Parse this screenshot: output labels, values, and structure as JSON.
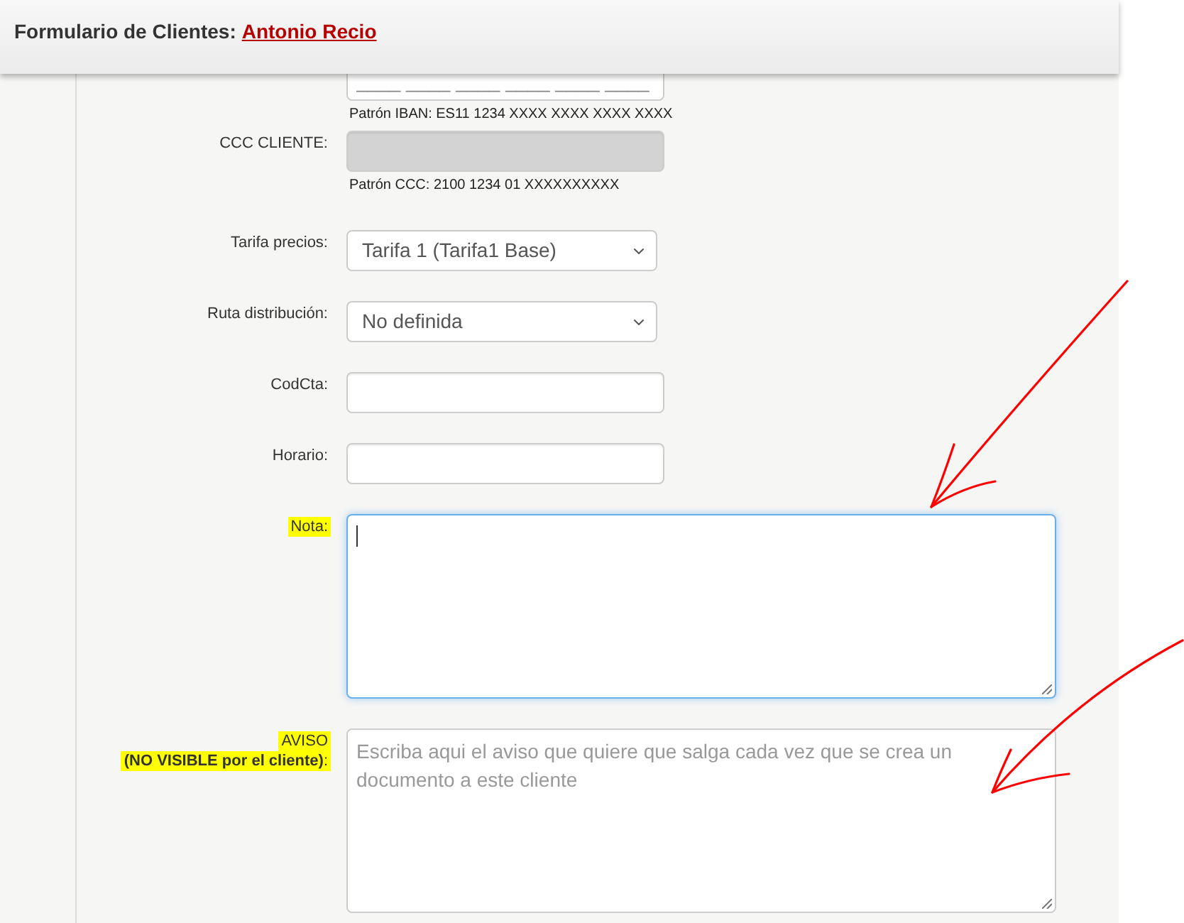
{
  "header": {
    "title": "Formulario de Clientes:",
    "client_name": "Antonio Recio"
  },
  "fields": [
    {
      "kind": "masked",
      "placeholder": "____ ____ ____ ____ ____ ____",
      "hint": "Patrón IBAN: ES11 1234 XXXX XXXX XXXX XXXX",
      "disabled": false,
      "focused": false
    },
    {
      "kind": "text",
      "label": "CCC CLIENTE:",
      "highlighted": false,
      "disabled": true,
      "focused": false,
      "hint": "Patrón CCC: 2100 1234 01 XXXXXXXXXX"
    },
    {
      "kind": "select",
      "label": "Tarifa precios:",
      "highlighted": false,
      "value": "Tarifa 1 (Tarifa1 Base)",
      "disabled": false,
      "focused": false
    },
    {
      "kind": "select",
      "label": "Ruta distribución:",
      "highlighted": false,
      "value": "No definida",
      "disabled": false,
      "focused": false
    },
    {
      "kind": "text",
      "label": "CodCta:",
      "highlighted": false,
      "disabled": false,
      "focused": false
    },
    {
      "kind": "text",
      "label": "Horario:",
      "highlighted": false,
      "disabled": false,
      "focused": false
    },
    {
      "kind": "textarea",
      "label": "Nota:",
      "highlighted": true,
      "disabled": false,
      "focused": true
    },
    {
      "kind": "textarea",
      "label": "AVISO",
      "sublabel": "**(NO VISIBLE por el cliente)**:",
      "highlighted": true,
      "disabled": false,
      "focused": false,
      "placeholder": "Escriba aqui el aviso que quiere que salga cada vez que se crea un documento a este cliente"
    }
  ]
}
